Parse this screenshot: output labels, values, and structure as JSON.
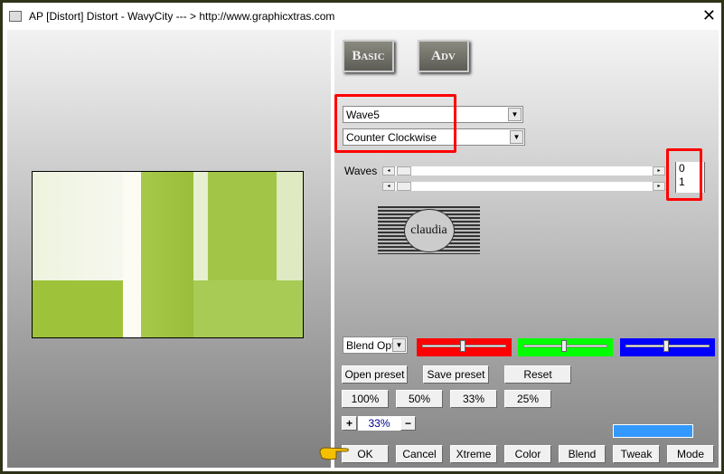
{
  "window": {
    "title": "AP [Distort]  Distort - WavyCity    --- > http://www.graphicxtras.com",
    "close": "✕"
  },
  "tabs": {
    "basic": "Basic",
    "adv": "Adv"
  },
  "dropdowns": {
    "wave": "Wave5",
    "direction": "Counter Clockwise",
    "blend": "Blend Opti"
  },
  "sliders": {
    "label": "Waves",
    "values": [
      "0",
      "1"
    ]
  },
  "logo": {
    "text": "claudia"
  },
  "colors": {
    "red": "#ff0000",
    "green": "#00ff00",
    "blue": "#0000ff",
    "swatch": "#3399ff"
  },
  "color_sliders": {
    "red": 0.5,
    "green": 0.5,
    "blue": 0.5
  },
  "buttons": {
    "open": "Open preset",
    "save": "Save preset",
    "reset": "Reset",
    "z100": "100%",
    "z50": "50%",
    "z33": "33%",
    "z25": "25%",
    "plus": "+",
    "minus": "−",
    "ok": "OK",
    "cancel": "Cancel",
    "xtreme": "Xtreme",
    "color": "Color",
    "blend": "Blend",
    "tweak": "Tweak",
    "mode": "Mode"
  },
  "zoom": {
    "value": "33%"
  }
}
